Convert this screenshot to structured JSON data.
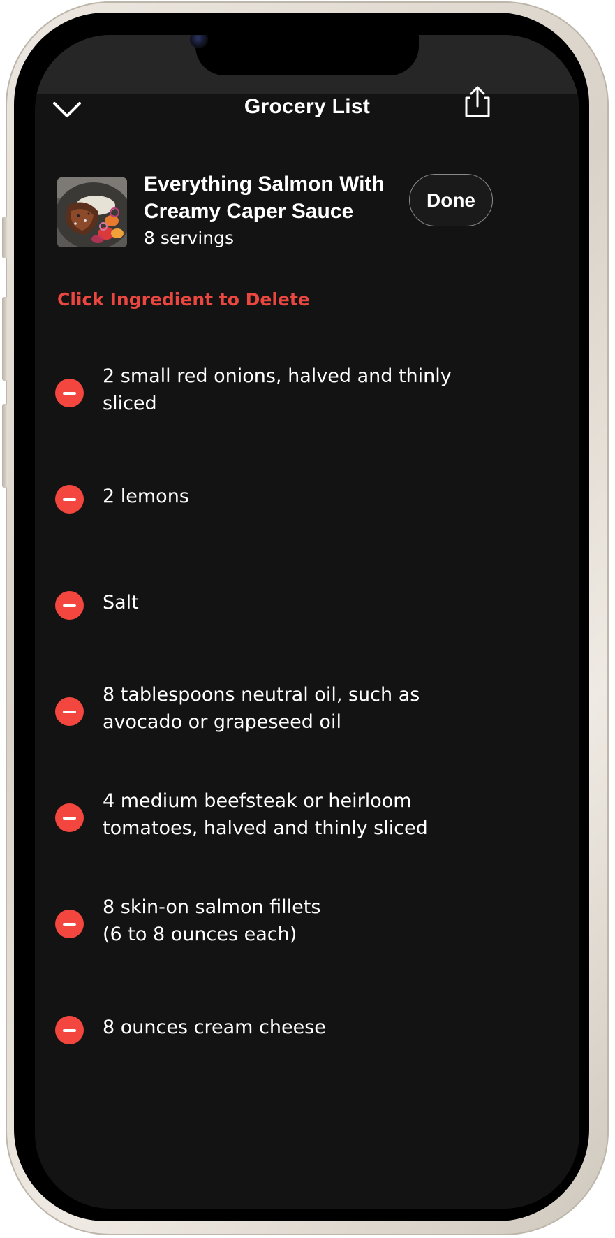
{
  "header": {
    "title": "Grocery List",
    "back_icon": "chevron-down-icon",
    "share_icon": "share-icon"
  },
  "recipe": {
    "title": "Everything Salmon With Creamy Caper Sauce",
    "servings": "8 servings",
    "done_label": "Done"
  },
  "instruction": "Click Ingredient to Delete",
  "ingredients": [
    {
      "text": "2 small red onions, halved and thinly sliced"
    },
    {
      "text": "2 lemons"
    },
    {
      "text": "Salt"
    },
    {
      "text": "8 tablespoons neutral oil, such as avocado or grapeseed oil"
    },
    {
      "text": "4 medium beefsteak or heirloom tomatoes, halved and thinly sliced"
    },
    {
      "text": "8 skin-on salmon fillets\n(6 to 8 ounces each)"
    },
    {
      "text": "8 ounces cream cheese"
    }
  ],
  "colors": {
    "accent": "#f2463e",
    "instruction": "#e9473f",
    "background": "#131313",
    "header": "#262626"
  }
}
